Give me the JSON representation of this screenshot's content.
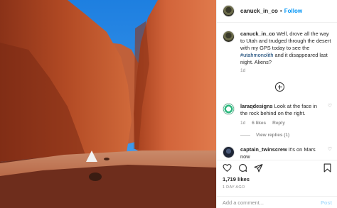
{
  "post": {
    "username": "canuck_in_co",
    "follow_label": "Follow",
    "dot": "•"
  },
  "caption": {
    "username": "canuck_in_co",
    "text_before": " Well, drove all the way to Utah and trudged through the desert with my GPS today to see the ",
    "hashtag": "#utahmonolith",
    "text_after": " and it disappeared last night. Aliens?",
    "time": "1d"
  },
  "comments": [
    {
      "username": "laraqdesigns",
      "text": " Look at the face in the rock behind on the right.",
      "time": "1d",
      "likes": "6 likes",
      "reply": "Reply",
      "view_replies": "View replies (1)"
    },
    {
      "username": "captain_twinscrew",
      "text": " It's on Mars now"
    }
  ],
  "stats": {
    "likes": "1,719 likes",
    "date": "1 DAY AGO"
  },
  "composer": {
    "placeholder": "Add a comment...",
    "post_label": "Post"
  },
  "icons": [
    "heart-icon",
    "comment-icon",
    "share-icon",
    "bookmark-icon",
    "add-circle-icon"
  ]
}
